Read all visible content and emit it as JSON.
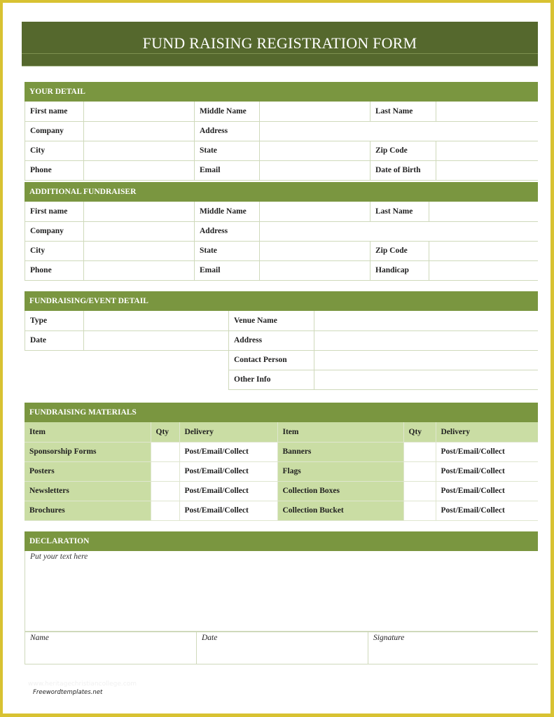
{
  "title": "FUND RAISING REGISTRATION FORM",
  "colors": {
    "title_bar": "#55682d",
    "section_header": "#7a9640",
    "material_fill": "#cadda4",
    "grid_line": "#cfd9bb",
    "page_border": "#d8c232"
  },
  "your_detail": {
    "heading": "YOUR DETAIL",
    "rows": [
      [
        "First name",
        "Middle Name",
        "Last Name"
      ],
      [
        "Company",
        "Address"
      ],
      [
        "City",
        "State",
        "Zip Code"
      ],
      [
        "Phone",
        "Email",
        "Date of Birth"
      ]
    ]
  },
  "additional_fundraiser": {
    "heading": "ADDITIONAL FUNDRAISER",
    "rows": [
      [
        "First name",
        "Middle Name",
        "Last Name"
      ],
      [
        "Company",
        "Address"
      ],
      [
        "City",
        "State",
        "Zip Code"
      ],
      [
        "Phone",
        "Email",
        "Handicap"
      ]
    ]
  },
  "event_detail": {
    "heading": "FUNDRAISING/EVENT DETAIL",
    "left": [
      "Type",
      "Date"
    ],
    "right": [
      "Venue Name",
      "Address",
      "Contact Person",
      "Other Info"
    ]
  },
  "materials": {
    "heading": "FUNDRAISING MATERIALS",
    "columns": [
      "Item",
      "Qty",
      "Delivery",
      "Item",
      "Qty",
      "Delivery"
    ],
    "rows": [
      {
        "item_left": "Sponsorship Forms",
        "qty_left": "",
        "delivery_left": "Post/Email/Collect",
        "item_right": "Banners",
        "qty_right": "",
        "delivery_right": "Post/Email/Collect"
      },
      {
        "item_left": "Posters",
        "qty_left": "",
        "delivery_left": "Post/Email/Collect",
        "item_right": "Flags",
        "qty_right": "",
        "delivery_right": "Post/Email/Collect"
      },
      {
        "item_left": "Newsletters",
        "qty_left": "",
        "delivery_left": "Post/Email/Collect",
        "item_right": "Collection Boxes",
        "qty_right": "",
        "delivery_right": "Post/Email/Collect"
      },
      {
        "item_left": "Brochures",
        "qty_left": "",
        "delivery_left": "Post/Email/Collect",
        "item_right": "Collection Bucket",
        "qty_right": "",
        "delivery_right": "Post/Email/Collect"
      }
    ]
  },
  "declaration": {
    "heading": "DECLARATION",
    "placeholder": "Put your text here",
    "signature_fields": [
      "Name",
      "Date",
      "Signature"
    ]
  },
  "footer": {
    "watermark": "www.heritagechristiancollege.com",
    "brand": "Freewordtemplates.net"
  }
}
